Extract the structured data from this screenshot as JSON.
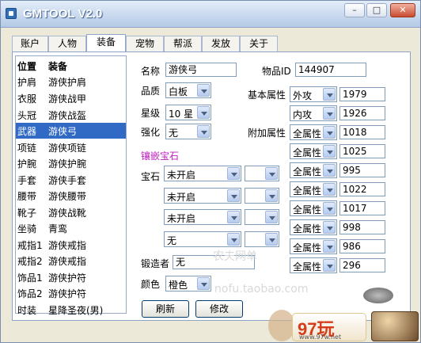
{
  "window": {
    "title": "GMTOOL  V2.0"
  },
  "tabs": [
    "账户",
    "人物",
    "装备",
    "宠物",
    "帮派",
    "发放",
    "关于"
  ],
  "list": {
    "header": {
      "slot": "位置",
      "item": "装备"
    },
    "rows": [
      {
        "slot": "护肩",
        "item": "游侠护肩"
      },
      {
        "slot": "衣服",
        "item": "游侠战甲"
      },
      {
        "slot": "头冠",
        "item": "游侠战盔"
      },
      {
        "slot": "武器",
        "item": "游侠弓"
      },
      {
        "slot": "项链",
        "item": "游侠项链"
      },
      {
        "slot": "护腕",
        "item": "游侠护腕"
      },
      {
        "slot": "手套",
        "item": "游侠手套"
      },
      {
        "slot": "腰带",
        "item": "游侠腰带"
      },
      {
        "slot": "靴子",
        "item": "游侠战靴"
      },
      {
        "slot": "坐骑",
        "item": "青鸾"
      },
      {
        "slot": "戒指1",
        "item": "游侠戒指"
      },
      {
        "slot": "戒指2",
        "item": "游侠戒指"
      },
      {
        "slot": "饰品1",
        "item": "游侠护符"
      },
      {
        "slot": "饰品2",
        "item": "游侠护符"
      },
      {
        "slot": "时装",
        "item": "星降圣夜(男)"
      }
    ]
  },
  "form": {
    "name_label": "名称",
    "name_value": "游侠弓",
    "item_id_label": "物品ID",
    "item_id_value": "144907",
    "quality_label": "品质",
    "quality_value": "白板",
    "star_label": "星级",
    "star_value": "10 星",
    "enhance_label": "强化",
    "enhance_value": "无",
    "base_attr_label": "基本属性",
    "base_attrs": [
      {
        "type": "外攻",
        "value": "1979"
      },
      {
        "type": "内攻",
        "value": "1926"
      }
    ],
    "extra_attr_label": "附加属性",
    "extra_attrs": [
      {
        "type": "全属性",
        "value": "1018"
      },
      {
        "type": "全属性",
        "value": "1025"
      },
      {
        "type": "全属性",
        "value": "995"
      },
      {
        "type": "全属性",
        "value": "1022"
      },
      {
        "type": "全属性",
        "value": "1017"
      },
      {
        "type": "全属性",
        "value": "998"
      },
      {
        "type": "全属性",
        "value": "986"
      },
      {
        "type": "全属性",
        "value": "296"
      }
    ],
    "gem_section": "镶嵌宝石",
    "gem_label": "宝石",
    "gems": [
      "未开启",
      "未开启",
      "未开启",
      "无"
    ],
    "forger_label": "锻造者",
    "forger_value": "无",
    "color_label": "颜色",
    "color_value": "橙色",
    "refresh_button": "刷新",
    "modify_button": "修改"
  },
  "watermarks": {
    "a": "农夫网单",
    "b": "nofu.taobao.com"
  },
  "branding": {
    "logo": "97玩",
    "url": "www.97w.net"
  }
}
